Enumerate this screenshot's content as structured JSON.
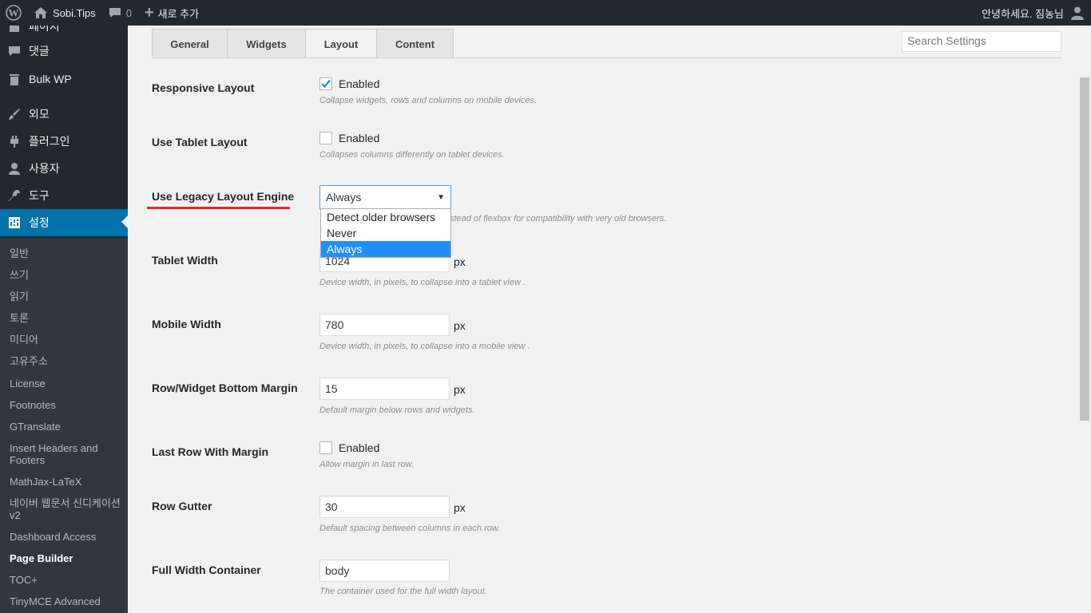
{
  "adminbar": {
    "site_name": "Sobi.Tips",
    "comments_count": "0",
    "new_label": "새로 추가",
    "greeting": "안녕하세요. 짐농님"
  },
  "sidebar": {
    "top_partial": "페이지",
    "items": [
      {
        "label": "댓글",
        "icon": "comment-icon"
      },
      {
        "label": "Bulk WP",
        "icon": "trash-icon"
      },
      {
        "label": "외모",
        "icon": "brush-icon"
      },
      {
        "label": "플러그인",
        "icon": "plugin-icon"
      },
      {
        "label": "사용자",
        "icon": "user-icon"
      },
      {
        "label": "도구",
        "icon": "wrench-icon"
      },
      {
        "label": "설정",
        "icon": "settings-icon"
      }
    ],
    "submenu": [
      "일반",
      "쓰기",
      "읽기",
      "토론",
      "미디어",
      "고유주소",
      "License",
      "Footnotes",
      "GTranslate",
      "Insert Headers and Footers",
      "MathJax-LaTeX",
      "네이버 웹문서 신디케이션v2",
      "Dashboard Access",
      "Page Builder",
      "TOC+",
      "TinyMCE Advanced"
    ],
    "current_submenu": "Page Builder",
    "accent_color": "#0073aa"
  },
  "tabs": [
    "General",
    "Widgets",
    "Layout",
    "Content"
  ],
  "active_tab": "Layout",
  "search_placeholder": "Search Settings",
  "settings": {
    "responsive": {
      "label": "Responsive Layout",
      "checkbox": "Enabled",
      "checked": true,
      "desc": "Collapse widgets, rows and columns on mobile devices."
    },
    "tablet_layout": {
      "label": "Use Tablet Layout",
      "checkbox": "Enabled",
      "checked": false,
      "desc": "Collapses columns differently on tablet devices."
    },
    "legacy": {
      "label": "Use Legacy Layout Engine",
      "value": "Always",
      "options": [
        "Detect older browsers",
        "Never",
        "Always"
      ],
      "desc": "stead of flexbox for compatibility with very old browsers."
    },
    "tablet_width": {
      "label": "Tablet Width",
      "value": "1024",
      "unit": "px",
      "desc": "Device width, in pixels, to collapse into a tablet view ."
    },
    "mobile_width": {
      "label": "Mobile Width",
      "value": "780",
      "unit": "px",
      "desc": "Device width, in pixels, to collapse into a mobile view ."
    },
    "bottom_margin": {
      "label": "Row/Widget Bottom Margin",
      "value": "15",
      "unit": "px",
      "desc": "Default margin below rows and widgets."
    },
    "last_row": {
      "label": "Last Row With Margin",
      "checkbox": "Enabled",
      "checked": false,
      "desc": "Allow margin in last row."
    },
    "gutter": {
      "label": "Row Gutter",
      "value": "30",
      "unit": "px",
      "desc": "Default spacing between columns in each row."
    },
    "full_width": {
      "label": "Full Width Container",
      "value": "body",
      "desc": "The container used for the full width layout."
    }
  },
  "annotation_color": "#e02b2b"
}
